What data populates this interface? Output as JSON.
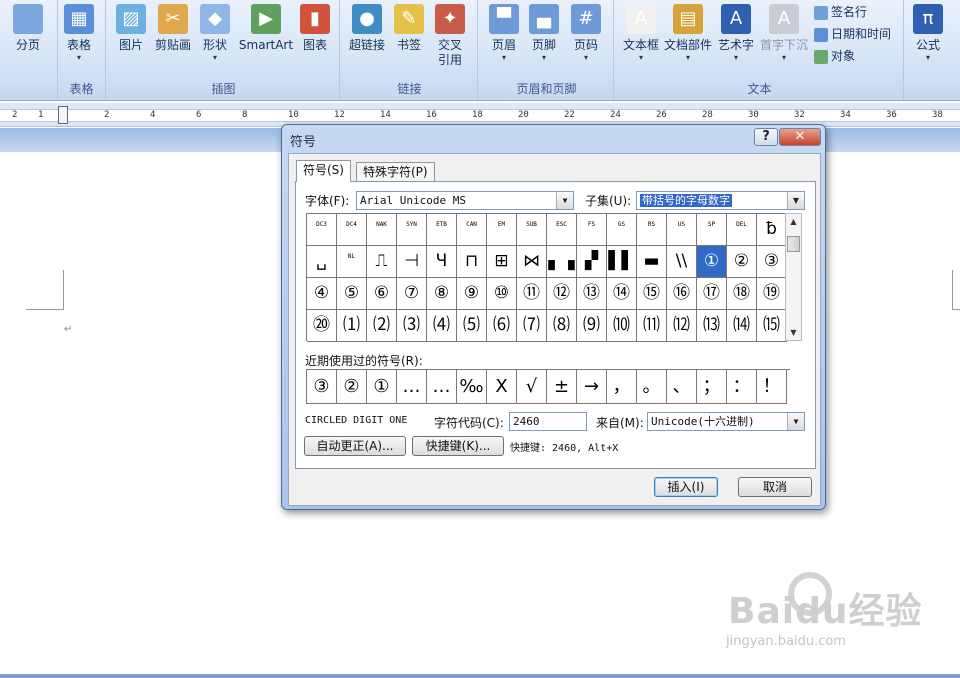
{
  "ribbon": {
    "buttons": [
      {
        "label": "分页",
        "icon": "page-break-icon"
      },
      {
        "label": "表格",
        "icon": "table-icon"
      },
      {
        "label": "图片",
        "icon": "picture-icon"
      },
      {
        "label": "剪贴画",
        "icon": "clipart-icon"
      },
      {
        "label": "形状",
        "icon": "shapes-icon"
      },
      {
        "label": "SmartArt",
        "icon": "smartart-icon"
      },
      {
        "label": "图表",
        "icon": "chart-icon"
      },
      {
        "label": "超链接",
        "icon": "hyperlink-icon"
      },
      {
        "label": "书签",
        "icon": "bookmark-icon"
      },
      {
        "label": "交叉\n引用",
        "icon": "cross-reference-icon"
      },
      {
        "label": "页眉",
        "icon": "header-icon"
      },
      {
        "label": "页脚",
        "icon": "footer-icon"
      },
      {
        "label": "页码",
        "icon": "page-number-icon"
      },
      {
        "label": "文本框",
        "icon": "textbox-icon"
      },
      {
        "label": "文档部件",
        "icon": "quick-parts-icon"
      },
      {
        "label": "艺术字",
        "icon": "wordart-icon"
      },
      {
        "label": "首字下沉",
        "icon": "dropcap-icon"
      },
      {
        "label": "公式",
        "icon": "equation-icon"
      }
    ],
    "small_buttons": [
      "签名行",
      "日期和时间",
      "对象"
    ],
    "groups": [
      "表格",
      "插图",
      "链接",
      "页眉和页脚",
      "文本"
    ],
    "ruler_numbers": [
      "2",
      "4",
      "6",
      "8",
      "10",
      "12",
      "14",
      "16",
      "18",
      "20",
      "22",
      "24",
      "26",
      "28",
      "30",
      "32",
      "34",
      "36",
      "38"
    ],
    "ruler_left": [
      "2",
      "1"
    ]
  },
  "dialog": {
    "title": "符号",
    "help": "?",
    "close": "✕",
    "tabs": [
      "符号(S)",
      "特殊字符(P)"
    ],
    "font_label": "字体(F):",
    "font_value": "Arial Unicode MS",
    "subset_label": "子集(U):",
    "subset_value": "带括号的字母数字",
    "symbols": [
      [
        "DC3",
        "DC4",
        "NAK",
        "SYN",
        "ETB",
        "CAN",
        "EM",
        "SUB",
        "ESC",
        "FS",
        "GS",
        "RS",
        "US",
        "SP",
        "DEL",
        "ƀ"
      ],
      [
        "␣",
        "NL",
        "⎍",
        "⊣",
        "Ч",
        "⊓",
        "⊞",
        "⋈",
        "▖▗",
        "▞",
        "▌▌",
        "▬",
        "\\\\",
        "①",
        "②",
        "③"
      ],
      [
        "④",
        "⑤",
        "⑥",
        "⑦",
        "⑧",
        "⑨",
        "⑩",
        "⑪",
        "⑫",
        "⑬",
        "⑭",
        "⑮",
        "⑯",
        "⑰",
        "⑱",
        "⑲"
      ],
      [
        "⑳",
        "⑴",
        "⑵",
        "⑶",
        "⑷",
        "⑸",
        "⑹",
        "⑺",
        "⑻",
        "⑼",
        "⑽",
        "⑾",
        "⑿",
        "⒀",
        "⒁",
        "⒂"
      ]
    ],
    "recent_label": "近期使用过的符号(R):",
    "recent": [
      "③",
      "②",
      "①",
      "…",
      "…",
      "‰",
      "X",
      "√",
      "±",
      "→",
      "，",
      "。",
      "、",
      "；",
      "：",
      "！"
    ],
    "char_name": "CIRCLED DIGIT ONE",
    "char_code_label": "字符代码(C):",
    "char_code": "2460",
    "from_label": "来自(M):",
    "from_value": "Unicode(十六进制)",
    "autocorrect": "自动更正(A)...",
    "shortcut_key": "快捷键(K)...",
    "shortcut_info": "快捷键: 2460, Alt+X",
    "insert": "插入(I)",
    "cancel": "取消"
  },
  "watermark": {
    "brand": "Baidu经验",
    "url": "jingyan.baidu.com"
  }
}
